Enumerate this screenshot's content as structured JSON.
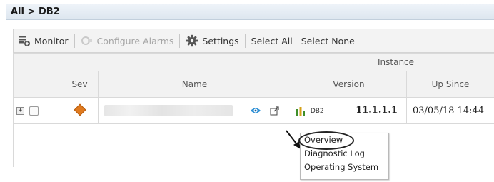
{
  "breadcrumb": {
    "root": "All",
    "separator": ">",
    "current": "DB2"
  },
  "toolbar": {
    "monitor_label": "Monitor",
    "configure_alarms_label": "Configure Alarms",
    "settings_label": "Settings",
    "select_all_label": "Select All",
    "select_none_label": "Select None"
  },
  "table": {
    "group_header": "Instance",
    "columns": {
      "sev": "Sev",
      "name": "Name",
      "version": "Version",
      "up_since": "Up Since"
    },
    "rows": [
      {
        "db_label": "DB2",
        "version": "11.1.1.1",
        "up_since": "03/05/18 14:44"
      }
    ]
  },
  "context_menu": {
    "items": [
      "Overview",
      "Diagnostic Log",
      "Operating System"
    ]
  },
  "colors": {
    "severity": "#e07a1f",
    "eye_icon": "#2b8fd6",
    "breadcrumb_bg": "#dde6ef"
  }
}
